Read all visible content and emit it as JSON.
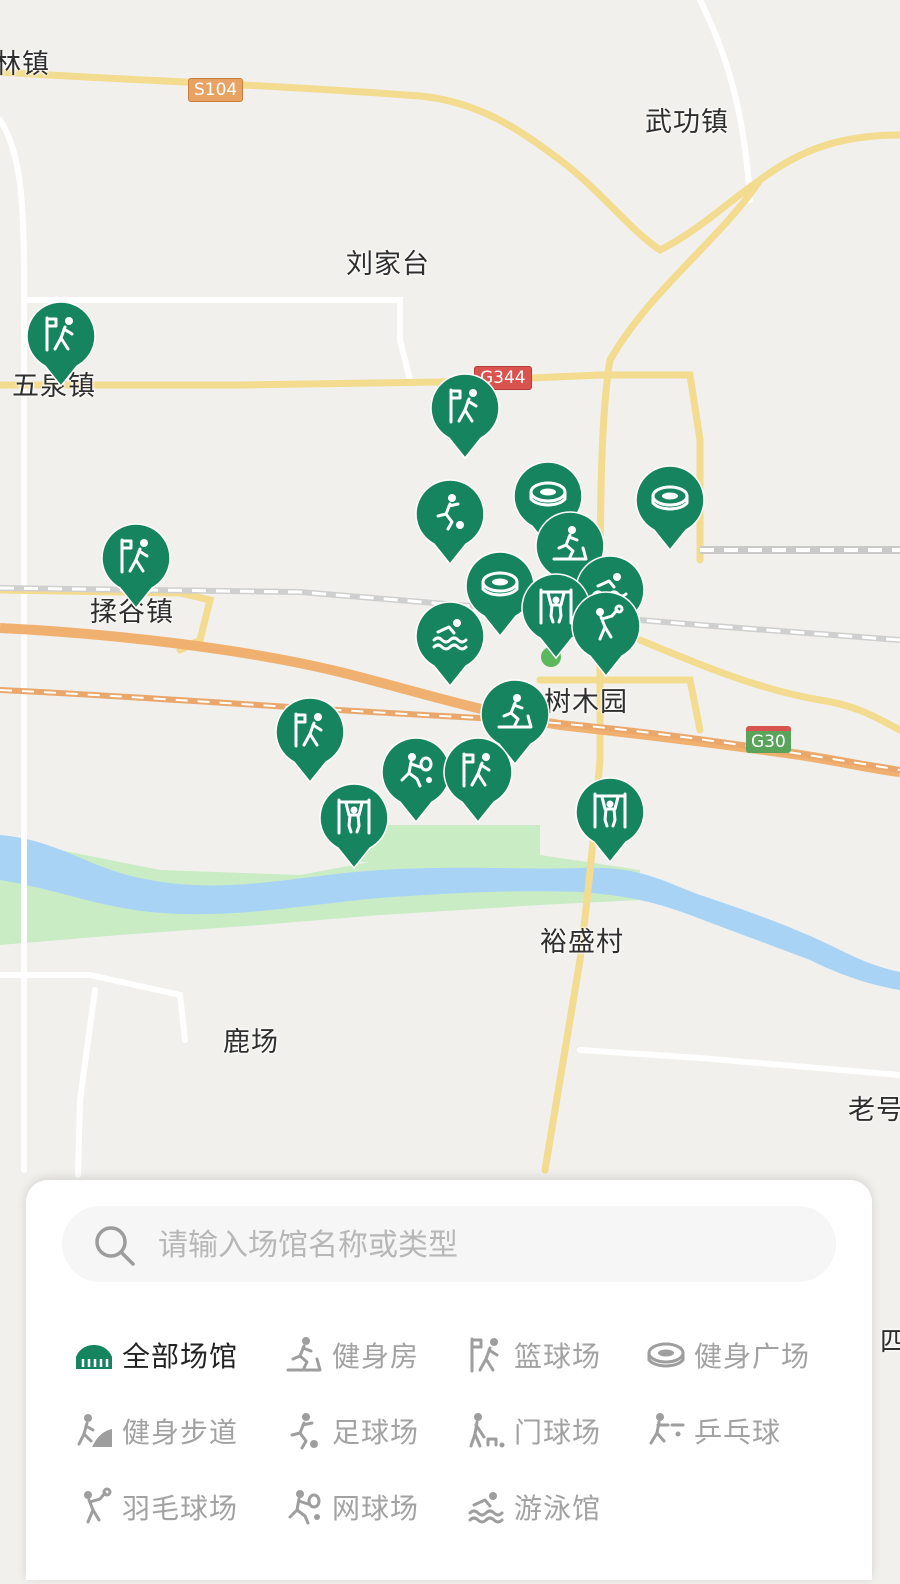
{
  "map": {
    "place_labels": [
      {
        "id": "linzhen",
        "text": "林镇"
      },
      {
        "id": "wugong",
        "text": "武功镇"
      },
      {
        "id": "liujiatai",
        "text": "刘家台"
      },
      {
        "id": "wuquan",
        "text": "五泉镇"
      },
      {
        "id": "rougu",
        "text": "揉谷镇"
      },
      {
        "id": "shumuyuan",
        "text": "树木园"
      },
      {
        "id": "yusheng",
        "text": "裕盛村"
      },
      {
        "id": "luchang",
        "text": "鹿场"
      },
      {
        "id": "laohao",
        "text": "老号"
      },
      {
        "id": "edge",
        "text": "四"
      }
    ],
    "road_shields": [
      {
        "id": "s104",
        "text": "S104",
        "color": "#e8a363"
      },
      {
        "id": "g344",
        "text": "G344",
        "color": "#d9534f"
      },
      {
        "id": "g30",
        "text": "G30",
        "color": "#5aa35a"
      }
    ],
    "marker_color": "#16855f",
    "markers": [
      {
        "type": "basketball",
        "icon": "basketball-icon"
      },
      {
        "type": "basketball",
        "icon": "basketball-icon"
      },
      {
        "type": "soccer",
        "icon": "soccer-icon"
      },
      {
        "type": "stadium",
        "icon": "stadium-icon"
      },
      {
        "type": "stadium",
        "icon": "stadium-icon"
      },
      {
        "type": "gym",
        "icon": "treadmill-icon"
      },
      {
        "type": "basketball",
        "icon": "basketball-icon"
      },
      {
        "type": "stadium",
        "icon": "stadium-icon"
      },
      {
        "type": "swimming",
        "icon": "swimming-icon"
      },
      {
        "type": "fitness-equipment",
        "icon": "pullup-icon"
      },
      {
        "type": "swimming",
        "icon": "swimming-icon"
      },
      {
        "type": "badminton",
        "icon": "badminton-icon"
      },
      {
        "type": "gym",
        "icon": "treadmill-icon"
      },
      {
        "type": "basketball",
        "icon": "basketball-icon"
      },
      {
        "type": "tennis",
        "icon": "tennis-icon"
      },
      {
        "type": "basketball",
        "icon": "basketball-icon"
      },
      {
        "type": "fitness-equipment",
        "icon": "pullup-icon"
      },
      {
        "type": "fitness-equipment",
        "icon": "pullup-icon"
      }
    ]
  },
  "search": {
    "placeholder": "请输入场馆名称或类型"
  },
  "categories": [
    {
      "label": "全部场馆",
      "icon": "all-venues-icon",
      "active": true
    },
    {
      "label": "健身房",
      "icon": "gym-icon",
      "active": false
    },
    {
      "label": "篮球场",
      "icon": "basketball-icon",
      "active": false
    },
    {
      "label": "健身广场",
      "icon": "fitness-plaza-icon",
      "active": false
    },
    {
      "label": "健身步道",
      "icon": "fitness-trail-icon",
      "active": false
    },
    {
      "label": "足球场",
      "icon": "soccer-icon",
      "active": false
    },
    {
      "label": "门球场",
      "icon": "gateball-icon",
      "active": false
    },
    {
      "label": "乒乓球",
      "icon": "ping-pong-icon",
      "active": false
    },
    {
      "label": "羽毛球场",
      "icon": "badminton-icon",
      "active": false
    },
    {
      "label": "网球场",
      "icon": "tennis-icon",
      "active": false
    },
    {
      "label": "游泳馆",
      "icon": "swimming-icon",
      "active": false
    }
  ]
}
